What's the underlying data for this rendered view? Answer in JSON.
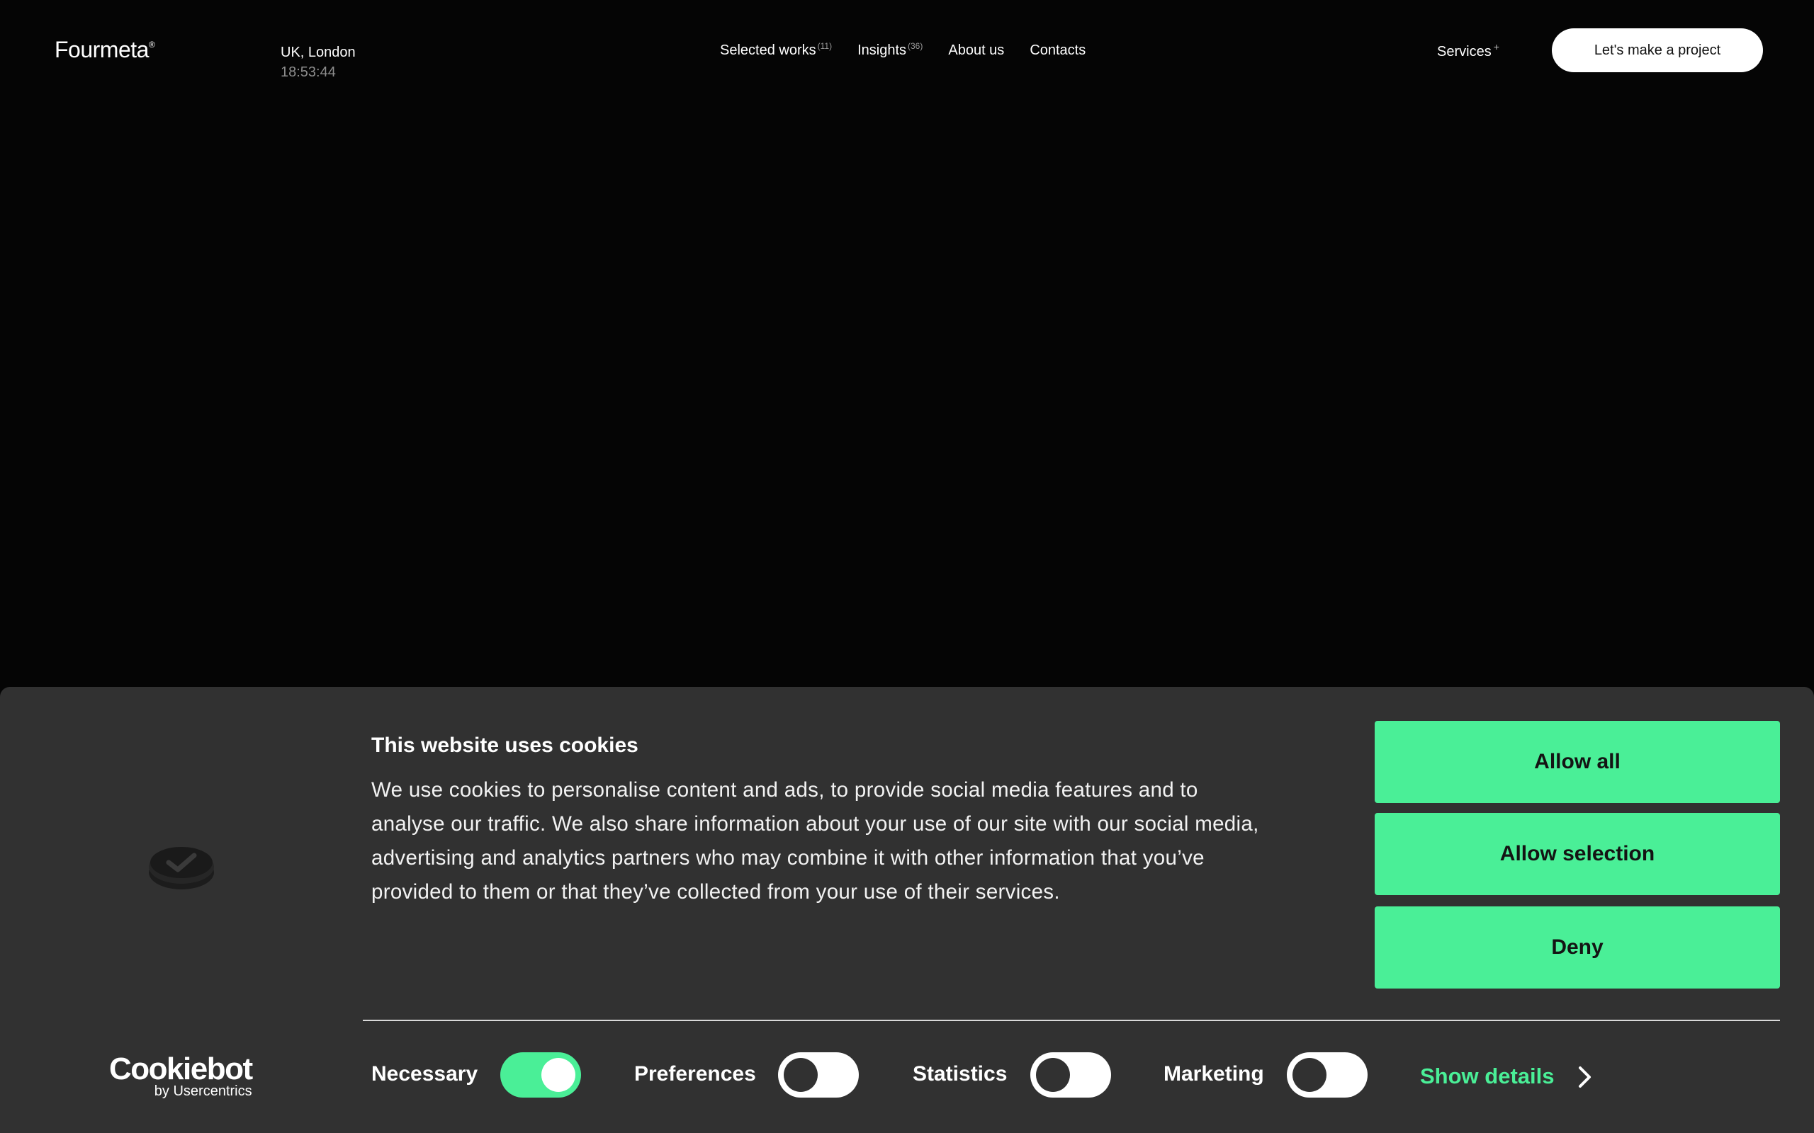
{
  "header": {
    "logo": "Fourmeta",
    "logo_mark": "®",
    "location": "UK, London",
    "clock": "18:53:44",
    "nav": [
      {
        "label": "Selected works",
        "count": "(11)"
      },
      {
        "label": "Insights",
        "count": "(36)"
      },
      {
        "label": "About us",
        "count": ""
      },
      {
        "label": "Contacts",
        "count": ""
      }
    ],
    "services": {
      "label": "Services",
      "mark": "+"
    },
    "cta": "Let's make a project"
  },
  "cookie_banner": {
    "title": "This website uses cookies",
    "text": "We use cookies to personalise content and ads, to provide social media features and to analyse our traffic. We also share information about your use of our site with our social media, advertising and analytics partners who may combine it with other information that you’ve provided to them or that they’ve collected from your use of their services.",
    "buttons": {
      "allow_all": "Allow all",
      "allow_selection": "Allow selection",
      "deny": "Deny"
    },
    "toggles": [
      {
        "label": "Necessary",
        "checked": true
      },
      {
        "label": "Preferences",
        "checked": false
      },
      {
        "label": "Statistics",
        "checked": false
      },
      {
        "label": "Marketing",
        "checked": false
      }
    ],
    "show_details": "Show details",
    "brand": {
      "name": "Cookiebot",
      "sub": "by Usercentrics"
    },
    "icons": {
      "consent": "consent-check-icon",
      "details": "chevron-right-icon"
    }
  },
  "colors": {
    "background": "#050505",
    "banner": "#313131",
    "accent": "#4aef97",
    "cta_bg": "#ffffff"
  }
}
